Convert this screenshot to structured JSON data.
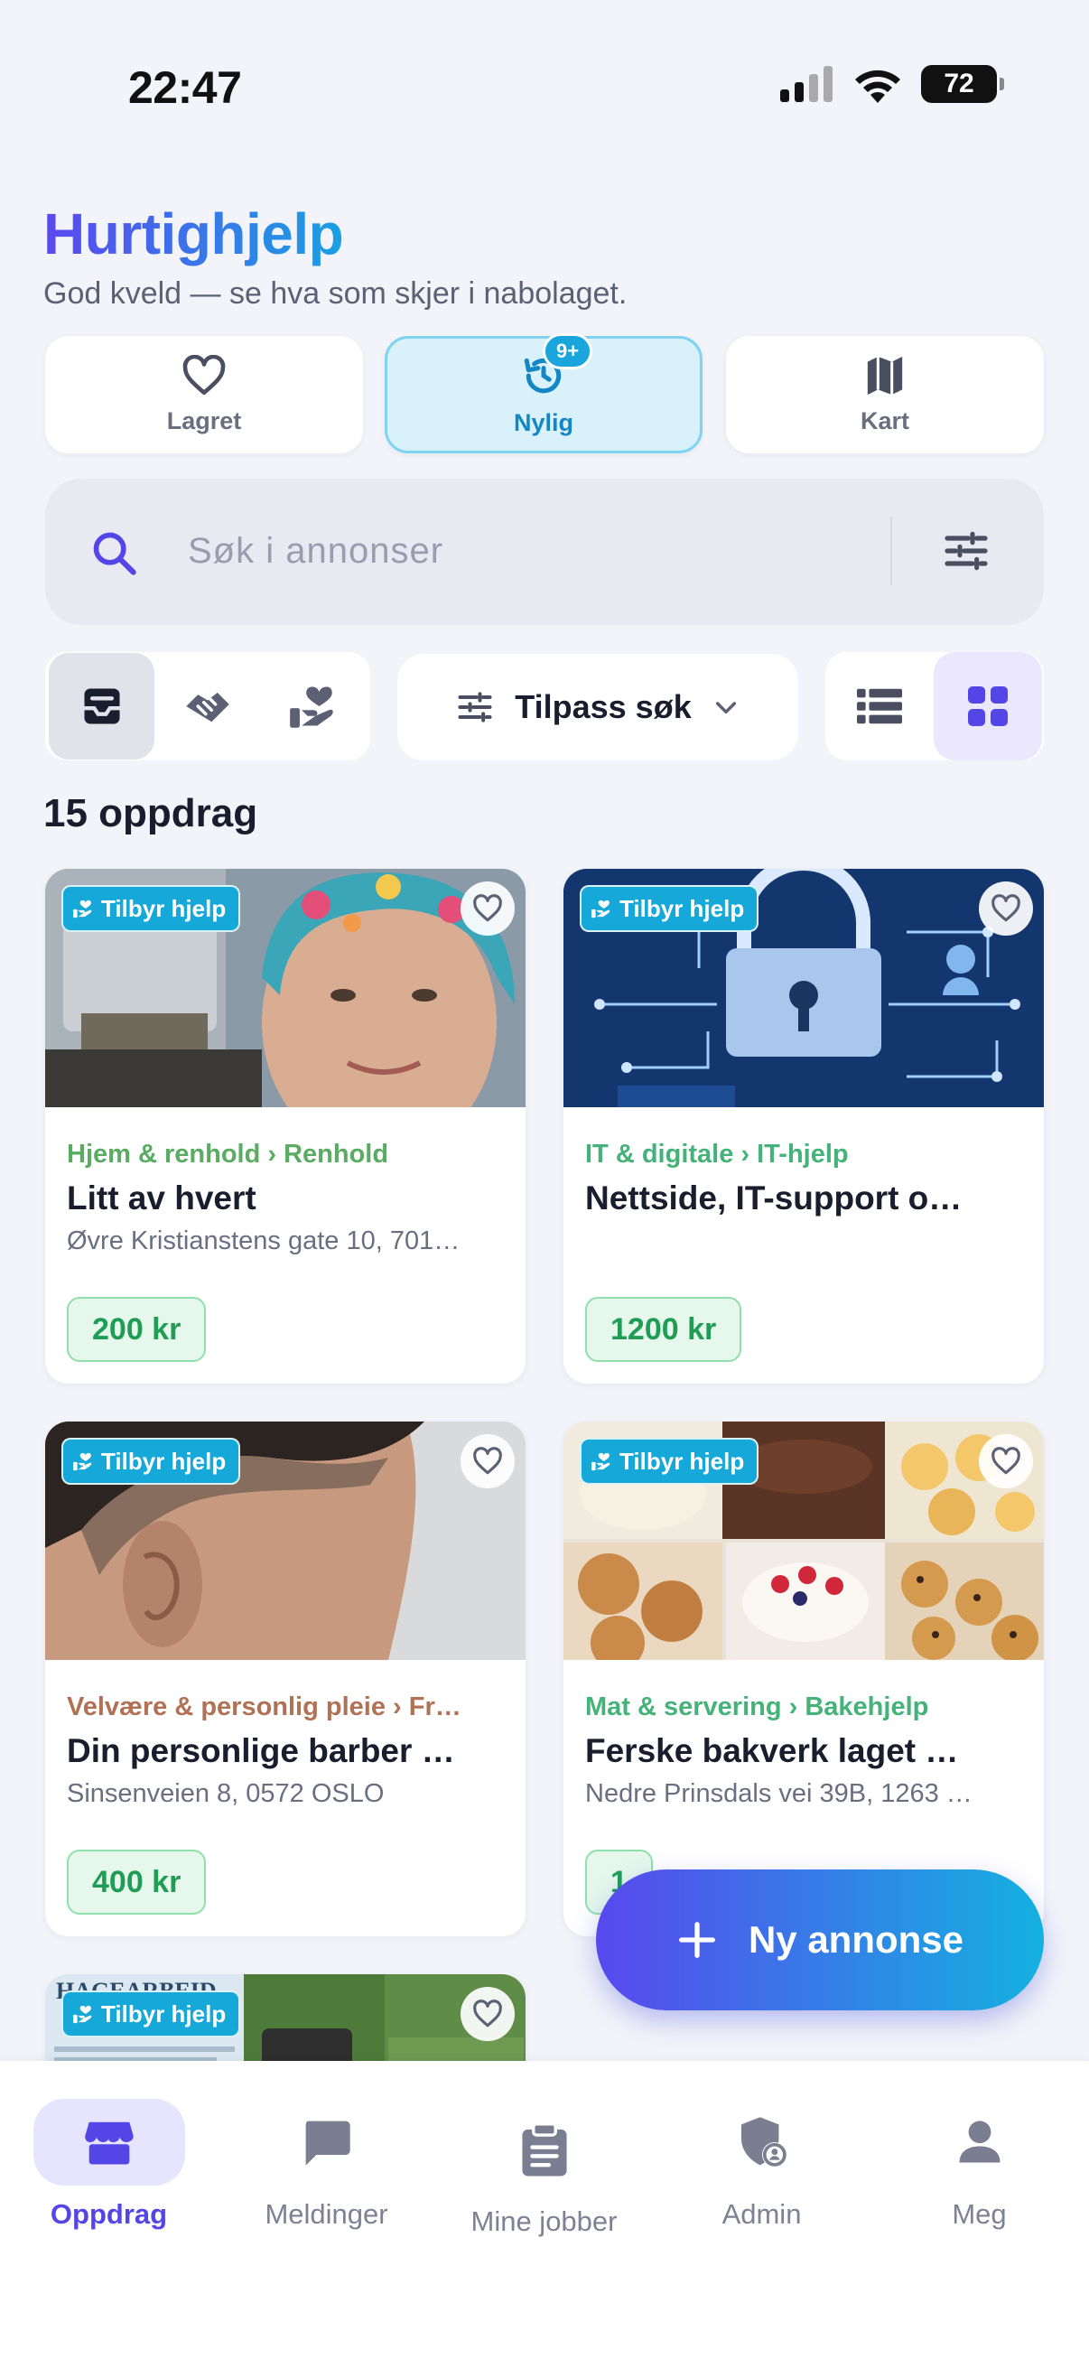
{
  "status_bar": {
    "time": "22:47",
    "battery": "72"
  },
  "header": {
    "title": "Hurtighjelp",
    "subtitle": "God kveld — se hva som skjer i nabolaget."
  },
  "quick_tabs": [
    {
      "label": "Lagret",
      "icon": "heart-icon"
    },
    {
      "label": "Nylig",
      "icon": "history-icon",
      "badge": "9+",
      "active": true
    },
    {
      "label": "Kart",
      "icon": "map-icon"
    }
  ],
  "search": {
    "placeholder": "Søk i annonser",
    "value": ""
  },
  "filters": {
    "segments": [
      "inbox-icon",
      "handshake-icon",
      "helping-hand-icon"
    ],
    "customize_label": "Tilpass søk",
    "view_modes": [
      "list-view-icon",
      "grid-view-icon"
    ],
    "active_view": "grid"
  },
  "results": {
    "count_label": "15 oppdrag"
  },
  "listings": [
    {
      "tag": "Tilbyr hjelp",
      "category": "Hjem & renhold › Renhold",
      "category_color": "#5aac63",
      "title": "Litt av hvert",
      "address": "Øvre Kristianstens gate 10, 701…",
      "price": "200 kr"
    },
    {
      "tag": "Tilbyr hjelp",
      "category": "IT & digitale › IT-hjelp",
      "category_color": "#45b27a",
      "title": "Nettside, IT-support o…",
      "address": "",
      "price": "1200 kr"
    },
    {
      "tag": "Tilbyr hjelp",
      "category": "Velvære & personlig pleie › Fr…",
      "category_color": "#b07154",
      "title": "Din personlige barber …",
      "address": "Sinsenveien 8, 0572 OSLO",
      "price": "400 kr"
    },
    {
      "tag": "Tilbyr hjelp",
      "category": "Mat & servering › Bakehjelp",
      "category_color": "#45b27a",
      "title": "Ferske bakverk laget …",
      "address": "Nedre Prinsdals vei 39B, 1263 …",
      "price": "1"
    },
    {
      "tag": "Tilbyr hjelp",
      "image_text": "HAGEARBEID"
    }
  ],
  "fab": {
    "label": "Ny annonse"
  },
  "bottom_nav": [
    {
      "label": "Oppdrag",
      "icon": "store-icon",
      "active": true
    },
    {
      "label": "Meldinger",
      "icon": "chat-icon"
    },
    {
      "label": "Mine jobber",
      "icon": "clipboard-icon"
    },
    {
      "label": "Admin",
      "icon": "admin-shield-icon"
    },
    {
      "label": "Meg",
      "icon": "person-icon"
    }
  ],
  "colors": {
    "brand_purple": "#5446e6",
    "brand_cyan": "#14b1e0",
    "price_green": "#1f9d55",
    "tag_blue": "#16a8d8"
  }
}
